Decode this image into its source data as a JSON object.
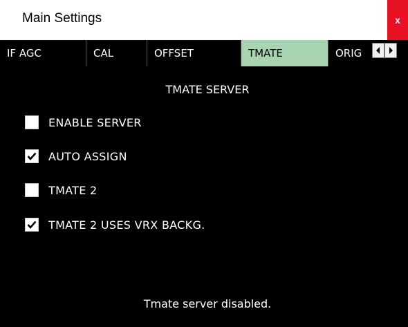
{
  "window": {
    "title": "Main Settings",
    "close_label": "x"
  },
  "tabs": [
    {
      "label": "IF AGC",
      "active": false
    },
    {
      "label": "CAL",
      "active": false
    },
    {
      "label": "OFFSET",
      "active": false
    },
    {
      "label": "TMATE",
      "active": true
    },
    {
      "label": "ORIG",
      "active": false
    }
  ],
  "tab_scroll": {
    "left_icon": "arrow-left-icon",
    "right_icon": "arrow-right-icon"
  },
  "panel": {
    "title": "TMATE SERVER",
    "options": [
      {
        "label": "ENABLE SERVER",
        "checked": false
      },
      {
        "label": "AUTO ASSIGN",
        "checked": true
      },
      {
        "label": "TMATE 2",
        "checked": false
      },
      {
        "label": "TMATE 2 USES VRX BACKG.",
        "checked": true
      }
    ],
    "status": "Tmate server disabled."
  },
  "colors": {
    "active_tab": "#a9d4b1",
    "close_button": "#e81123",
    "background": "#000000"
  }
}
